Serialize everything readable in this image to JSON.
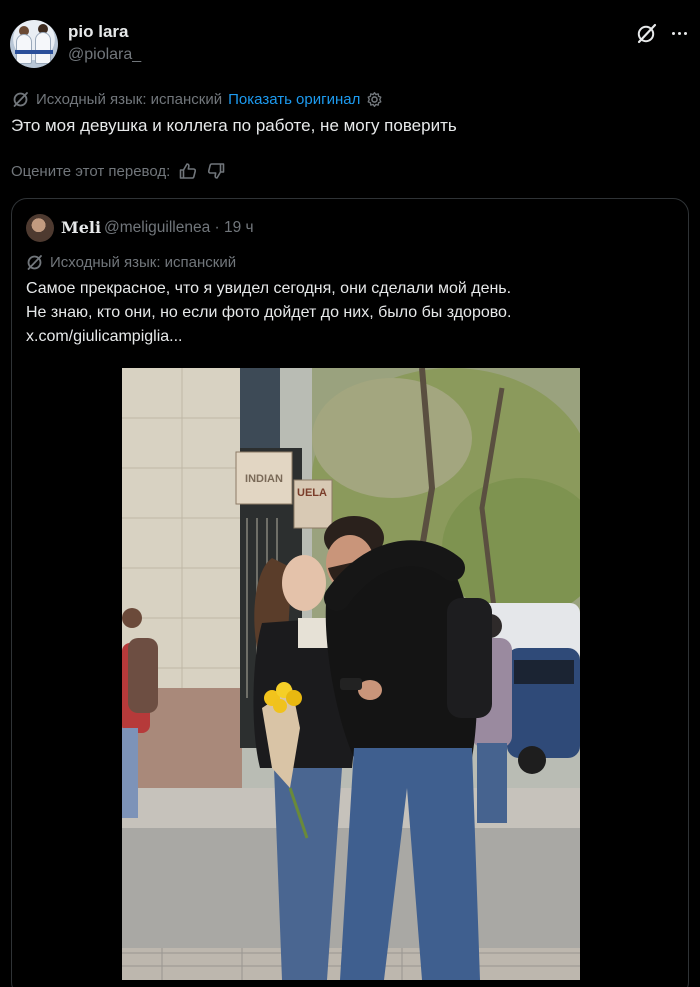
{
  "author": {
    "name": "pio lara",
    "handle": "@piolara_"
  },
  "translation": {
    "source_label": "Исходный язык: испанский",
    "show_original": "Показать оригинал"
  },
  "tweet": {
    "text": "Это моя девушка и коллега по работе, не могу поверить"
  },
  "rating": {
    "label": "Оцените этот перевод:"
  },
  "quoted": {
    "name": "Meli",
    "handle_time": "@meliguillenea · 19 ч",
    "translation_label": "Исходный язык: испанский",
    "lines": [
      "Самое прекрасное, что я увидел сегодня, они сделали мой день.",
      "Не знаю, кто они, но если фото дойдет до них, было бы здорово.",
      "x.com/giulicampiglia..."
    ],
    "photo": {
      "signs": [
        "INDIAN",
        "UELA"
      ]
    }
  },
  "colors": {
    "background": "#000000",
    "text": "#e7e9ea",
    "secondary": "#71767b",
    "link": "#1d9bf0",
    "border": "#2f3336"
  },
  "icons": [
    "grok-icon",
    "more-icon",
    "translate-icon",
    "settings-icon",
    "thumbs-up-icon",
    "thumbs-down-icon"
  ]
}
